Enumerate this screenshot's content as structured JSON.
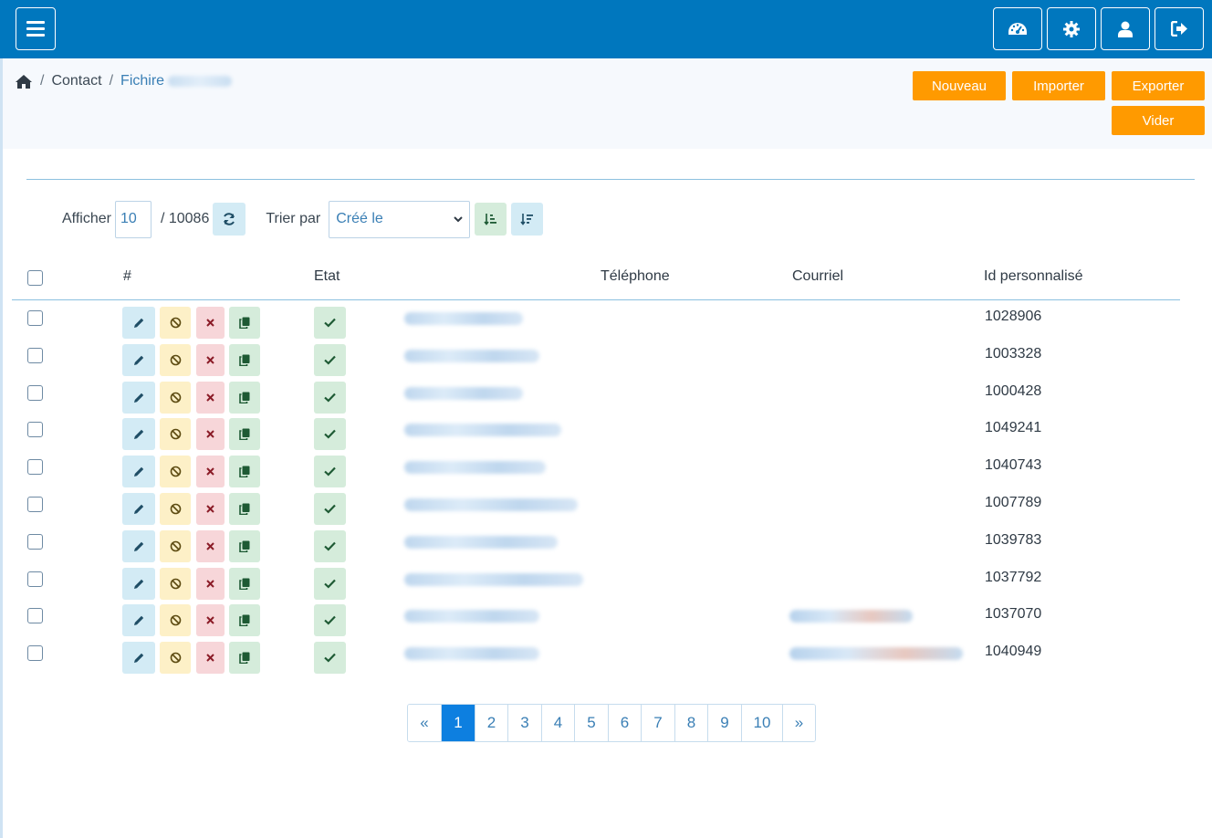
{
  "topbar": {
    "menu_icon": "hamburger-icon",
    "right_icons": [
      "dashboard-gauge-icon",
      "gear-icon",
      "user-icon",
      "logout-icon"
    ]
  },
  "breadcrumb": {
    "home_icon": "home-icon",
    "items": [
      "Contact",
      "Fichire"
    ]
  },
  "actions": {
    "new": "Nouveau",
    "import": "Importer",
    "export": "Exporter",
    "clear": "Vider"
  },
  "controls": {
    "show_label": "Afficher",
    "per_page": "10",
    "total": "/ 10086",
    "sort_label": "Trier par",
    "sort_value": "Créé le"
  },
  "table": {
    "headers": [
      "#",
      "Etat",
      "Téléphone",
      "Courriel",
      "Id personnalisé"
    ],
    "rows": [
      {
        "id": "1028906",
        "has_email": false
      },
      {
        "id": "1003328",
        "has_email": false
      },
      {
        "id": "1000428",
        "has_email": false
      },
      {
        "id": "1049241",
        "has_email": false
      },
      {
        "id": "1040743",
        "has_email": false
      },
      {
        "id": "1007789",
        "has_email": false
      },
      {
        "id": "1039783",
        "has_email": false
      },
      {
        "id": "1037792",
        "has_email": false
      },
      {
        "id": "1037070",
        "has_email": true
      },
      {
        "id": "1040949",
        "has_email": true
      }
    ]
  },
  "pagination": {
    "prev": "«",
    "pages": [
      "1",
      "2",
      "3",
      "4",
      "5",
      "6",
      "7",
      "8",
      "9",
      "10"
    ],
    "next": "»",
    "active": "1"
  },
  "colors": {
    "topbar": "#0077be",
    "accent_orange": "#ff9a00",
    "active_page": "#0d7fe0"
  }
}
